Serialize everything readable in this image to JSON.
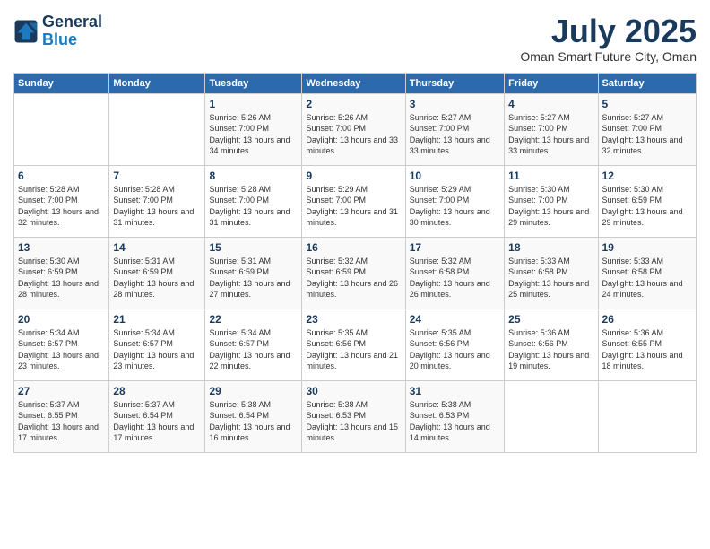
{
  "logo": {
    "line1": "General",
    "line2": "Blue"
  },
  "title": "July 2025",
  "subtitle": "Oman Smart Future City, Oman",
  "days_of_week": [
    "Sunday",
    "Monday",
    "Tuesday",
    "Wednesday",
    "Thursday",
    "Friday",
    "Saturday"
  ],
  "weeks": [
    [
      null,
      null,
      {
        "num": "1",
        "sunrise": "5:26 AM",
        "sunset": "7:00 PM",
        "daylight": "13 hours and 34 minutes."
      },
      {
        "num": "2",
        "sunrise": "5:26 AM",
        "sunset": "7:00 PM",
        "daylight": "13 hours and 33 minutes."
      },
      {
        "num": "3",
        "sunrise": "5:27 AM",
        "sunset": "7:00 PM",
        "daylight": "13 hours and 33 minutes."
      },
      {
        "num": "4",
        "sunrise": "5:27 AM",
        "sunset": "7:00 PM",
        "daylight": "13 hours and 33 minutes."
      },
      {
        "num": "5",
        "sunrise": "5:27 AM",
        "sunset": "7:00 PM",
        "daylight": "13 hours and 32 minutes."
      }
    ],
    [
      {
        "num": "6",
        "sunrise": "5:28 AM",
        "sunset": "7:00 PM",
        "daylight": "13 hours and 32 minutes."
      },
      {
        "num": "7",
        "sunrise": "5:28 AM",
        "sunset": "7:00 PM",
        "daylight": "13 hours and 31 minutes."
      },
      {
        "num": "8",
        "sunrise": "5:28 AM",
        "sunset": "7:00 PM",
        "daylight": "13 hours and 31 minutes."
      },
      {
        "num": "9",
        "sunrise": "5:29 AM",
        "sunset": "7:00 PM",
        "daylight": "13 hours and 31 minutes."
      },
      {
        "num": "10",
        "sunrise": "5:29 AM",
        "sunset": "7:00 PM",
        "daylight": "13 hours and 30 minutes."
      },
      {
        "num": "11",
        "sunrise": "5:30 AM",
        "sunset": "7:00 PM",
        "daylight": "13 hours and 29 minutes."
      },
      {
        "num": "12",
        "sunrise": "5:30 AM",
        "sunset": "6:59 PM",
        "daylight": "13 hours and 29 minutes."
      }
    ],
    [
      {
        "num": "13",
        "sunrise": "5:30 AM",
        "sunset": "6:59 PM",
        "daylight": "13 hours and 28 minutes."
      },
      {
        "num": "14",
        "sunrise": "5:31 AM",
        "sunset": "6:59 PM",
        "daylight": "13 hours and 28 minutes."
      },
      {
        "num": "15",
        "sunrise": "5:31 AM",
        "sunset": "6:59 PM",
        "daylight": "13 hours and 27 minutes."
      },
      {
        "num": "16",
        "sunrise": "5:32 AM",
        "sunset": "6:59 PM",
        "daylight": "13 hours and 26 minutes."
      },
      {
        "num": "17",
        "sunrise": "5:32 AM",
        "sunset": "6:58 PM",
        "daylight": "13 hours and 26 minutes."
      },
      {
        "num": "18",
        "sunrise": "5:33 AM",
        "sunset": "6:58 PM",
        "daylight": "13 hours and 25 minutes."
      },
      {
        "num": "19",
        "sunrise": "5:33 AM",
        "sunset": "6:58 PM",
        "daylight": "13 hours and 24 minutes."
      }
    ],
    [
      {
        "num": "20",
        "sunrise": "5:34 AM",
        "sunset": "6:57 PM",
        "daylight": "13 hours and 23 minutes."
      },
      {
        "num": "21",
        "sunrise": "5:34 AM",
        "sunset": "6:57 PM",
        "daylight": "13 hours and 23 minutes."
      },
      {
        "num": "22",
        "sunrise": "5:34 AM",
        "sunset": "6:57 PM",
        "daylight": "13 hours and 22 minutes."
      },
      {
        "num": "23",
        "sunrise": "5:35 AM",
        "sunset": "6:56 PM",
        "daylight": "13 hours and 21 minutes."
      },
      {
        "num": "24",
        "sunrise": "5:35 AM",
        "sunset": "6:56 PM",
        "daylight": "13 hours and 20 minutes."
      },
      {
        "num": "25",
        "sunrise": "5:36 AM",
        "sunset": "6:56 PM",
        "daylight": "13 hours and 19 minutes."
      },
      {
        "num": "26",
        "sunrise": "5:36 AM",
        "sunset": "6:55 PM",
        "daylight": "13 hours and 18 minutes."
      }
    ],
    [
      {
        "num": "27",
        "sunrise": "5:37 AM",
        "sunset": "6:55 PM",
        "daylight": "13 hours and 17 minutes."
      },
      {
        "num": "28",
        "sunrise": "5:37 AM",
        "sunset": "6:54 PM",
        "daylight": "13 hours and 17 minutes."
      },
      {
        "num": "29",
        "sunrise": "5:38 AM",
        "sunset": "6:54 PM",
        "daylight": "13 hours and 16 minutes."
      },
      {
        "num": "30",
        "sunrise": "5:38 AM",
        "sunset": "6:53 PM",
        "daylight": "13 hours and 15 minutes."
      },
      {
        "num": "31",
        "sunrise": "5:38 AM",
        "sunset": "6:53 PM",
        "daylight": "13 hours and 14 minutes."
      },
      null,
      null
    ]
  ]
}
